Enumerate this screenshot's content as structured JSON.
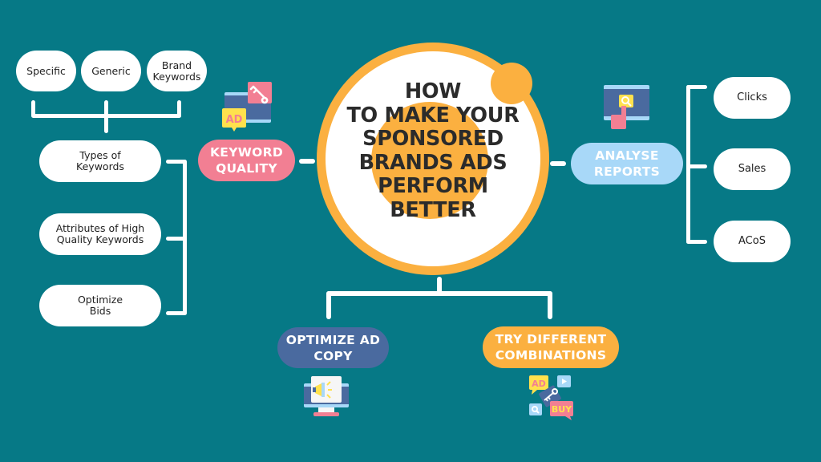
{
  "title": "HOW\nTO MAKE YOUR\nSPONSORED\nBRANDS ADS\nPERFORM\nBETTER",
  "colors": {
    "background": "#067986",
    "central_ring": "#FBB040",
    "keyword_quality": "#F27F93",
    "analyse_reports": "#A8D8F8",
    "optimize_ad_copy": "#4A6A9F",
    "try_different_combinations": "#FBB040",
    "node": "#FFFFFF"
  },
  "branches": {
    "keyword_quality": {
      "label": "KEYWORD\nQUALITY",
      "icon": "ad-keyword-icon",
      "children": [
        {
          "label": "Types of\nKeywords",
          "children": [
            "Specific",
            "Generic",
            "Brand\nKeywords"
          ]
        },
        {
          "label": "Attributes of High\nQuality Keywords"
        },
        {
          "label": "Optimize\nBids"
        }
      ]
    },
    "analyse_reports": {
      "label": "ANALYSE\nREPORTS",
      "icon": "report-monitor-icon",
      "children": [
        "Clicks",
        "Sales",
        "ACoS"
      ]
    },
    "optimize_ad_copy": {
      "label": "OPTIMIZE AD\nCOPY",
      "icon": "megaphone-monitor-icon"
    },
    "try_different_combinations": {
      "label": "TRY DIFFERENT\nCOMBINATIONS",
      "icon": "ad-buy-combination-icon",
      "icon_texts": {
        "ad": "AD",
        "buy": "BUY"
      }
    }
  }
}
